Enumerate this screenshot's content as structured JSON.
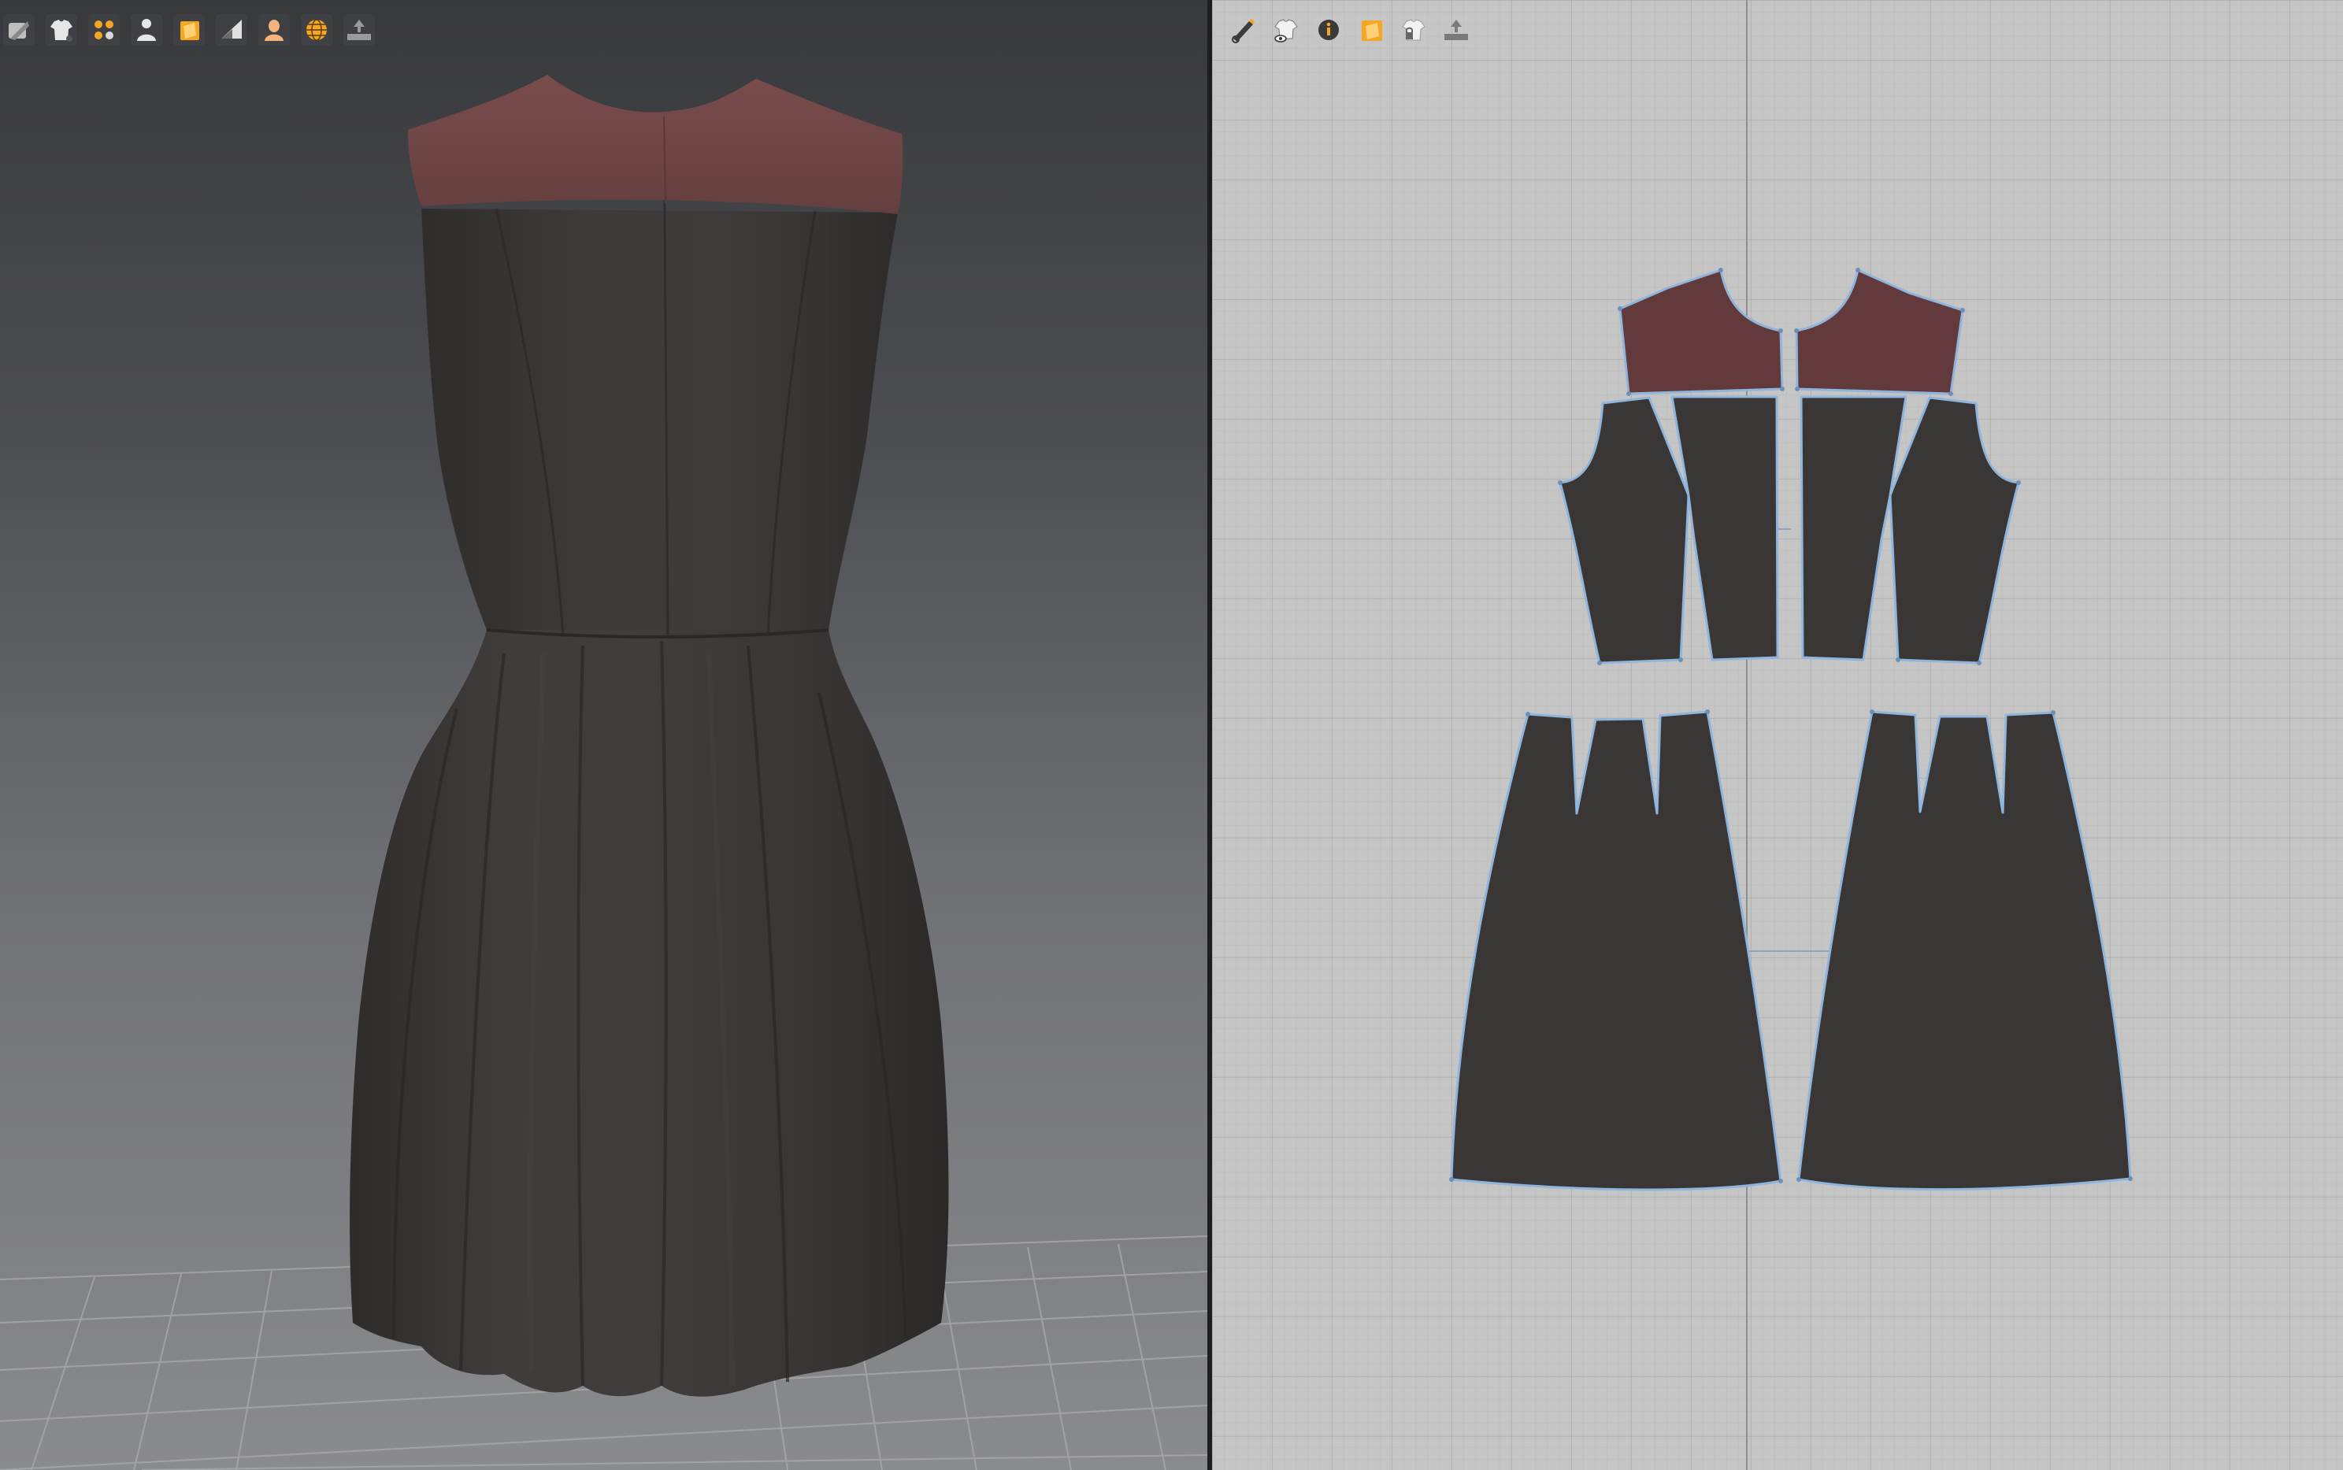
{
  "app": {
    "colors": {
      "fabric_main": "#3a3736",
      "fabric_yoke": "#6b4545",
      "pattern_outline": "#8fb5dc",
      "viewport_3d_top": "#38393d",
      "viewport_3d_bottom": "#8a8b8d",
      "viewport_2d_bg": "#c5c5c5",
      "toolbar_highlight": "#f5a623"
    }
  },
  "viewport_3d": {
    "toolbar": [
      {
        "icon": "avatar-display-icon"
      },
      {
        "icon": "garment-view-icon"
      },
      {
        "icon": "pins-icon"
      },
      {
        "icon": "avatar-icon"
      },
      {
        "icon": "texture-view-icon"
      },
      {
        "icon": "render-mode-icon"
      },
      {
        "icon": "skin-icon"
      },
      {
        "icon": "globe-icon"
      },
      {
        "icon": "measure-icon"
      }
    ]
  },
  "viewport_2d": {
    "toolbar": [
      {
        "icon": "edit-pattern-icon"
      },
      {
        "icon": "garment-visibility-icon"
      },
      {
        "icon": "info-icon"
      },
      {
        "icon": "texture-view-icon"
      },
      {
        "icon": "lock-garment-icon"
      },
      {
        "icon": "measure-icon"
      }
    ],
    "pattern_pieces": [
      {
        "name": "front-yoke-left",
        "fabric": "yoke"
      },
      {
        "name": "front-yoke-right",
        "fabric": "yoke"
      },
      {
        "name": "bodice-side-left",
        "fabric": "main"
      },
      {
        "name": "bodice-center-left",
        "fabric": "main"
      },
      {
        "name": "bodice-center-right",
        "fabric": "main"
      },
      {
        "name": "bodice-side-right",
        "fabric": "main"
      },
      {
        "name": "skirt-left",
        "fabric": "main"
      },
      {
        "name": "skirt-right",
        "fabric": "main"
      }
    ]
  }
}
